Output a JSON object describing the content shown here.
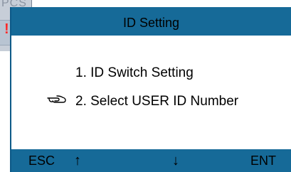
{
  "background_window": {
    "fragment_text": "PCS",
    "warning_mark": "!"
  },
  "screen": {
    "title": "ID Setting",
    "items": [
      {
        "label": "1.  ID Switch Setting",
        "selected": false
      },
      {
        "label": "2.  Select USER ID Number",
        "selected": true
      }
    ],
    "pointer_icon": "pointing-hand-icon",
    "softkeys": {
      "esc": "ESC",
      "up": "↑",
      "down": "↓",
      "ent": "ENT"
    }
  },
  "colors": {
    "bar": "#166a98",
    "background": "#ffffff",
    "warning": "#ff2a2a"
  }
}
